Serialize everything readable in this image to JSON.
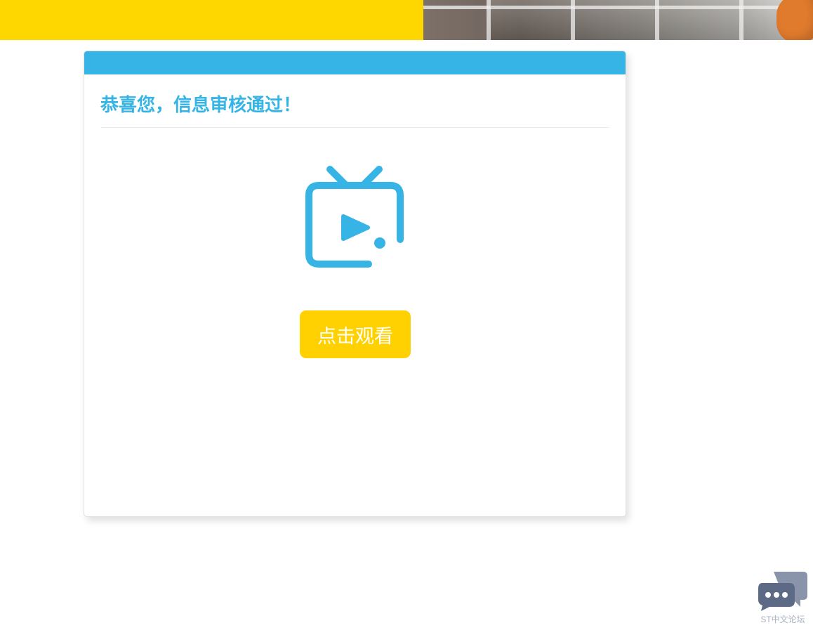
{
  "banner": {
    "background_color": "#ffd700",
    "image": "banner-photo"
  },
  "card": {
    "header_color": "#36b4e5",
    "title": "恭喜您，信息审核通过！",
    "icon": "tv-play-icon",
    "button_label": "点击观看",
    "button_color": "#ffd100"
  },
  "forum_badge": {
    "icon": "chat-bubbles-icon",
    "label": "ST中文论坛"
  }
}
